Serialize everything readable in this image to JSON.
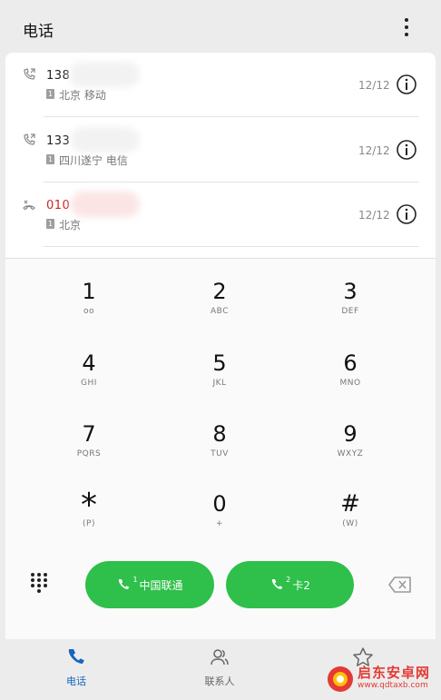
{
  "header": {
    "title": "电话"
  },
  "calls": [
    {
      "number": "138",
      "location": "北京 移动",
      "date": "12/12",
      "sim": "1",
      "status": "outgoing",
      "missed": false
    },
    {
      "number": "133",
      "location": "四川遂宁 电信",
      "date": "12/12",
      "sim": "1",
      "status": "outgoing",
      "missed": false
    },
    {
      "number": "010",
      "location": "北京",
      "date": "12/12",
      "sim": "1",
      "status": "missed",
      "missed": true
    }
  ],
  "keypad": {
    "keys": [
      {
        "digit": "1",
        "letters": "oo"
      },
      {
        "digit": "2",
        "letters": "ABC"
      },
      {
        "digit": "3",
        "letters": "DEF"
      },
      {
        "digit": "4",
        "letters": "GHI"
      },
      {
        "digit": "5",
        "letters": "JKL"
      },
      {
        "digit": "6",
        "letters": "MNO"
      },
      {
        "digit": "7",
        "letters": "PQRS"
      },
      {
        "digit": "8",
        "letters": "TUV"
      },
      {
        "digit": "9",
        "letters": "WXYZ"
      },
      {
        "digit": "*",
        "letters": "(P)"
      },
      {
        "digit": "0",
        "letters": "+"
      },
      {
        "digit": "#",
        "letters": "(W)"
      }
    ]
  },
  "actions": {
    "sim1_badge": "1",
    "sim1_label": "中国联通",
    "sim2_badge": "2",
    "sim2_label": "卡2"
  },
  "nav": {
    "phone_label": "电话",
    "contacts_label": "联系人"
  },
  "watermark": {
    "title": "启东安卓网",
    "url": "www.qdtaxb.com"
  },
  "colors": {
    "accent_blue": "#1565c0",
    "call_green": "#2ec04a",
    "missed_red": "#c62828"
  }
}
